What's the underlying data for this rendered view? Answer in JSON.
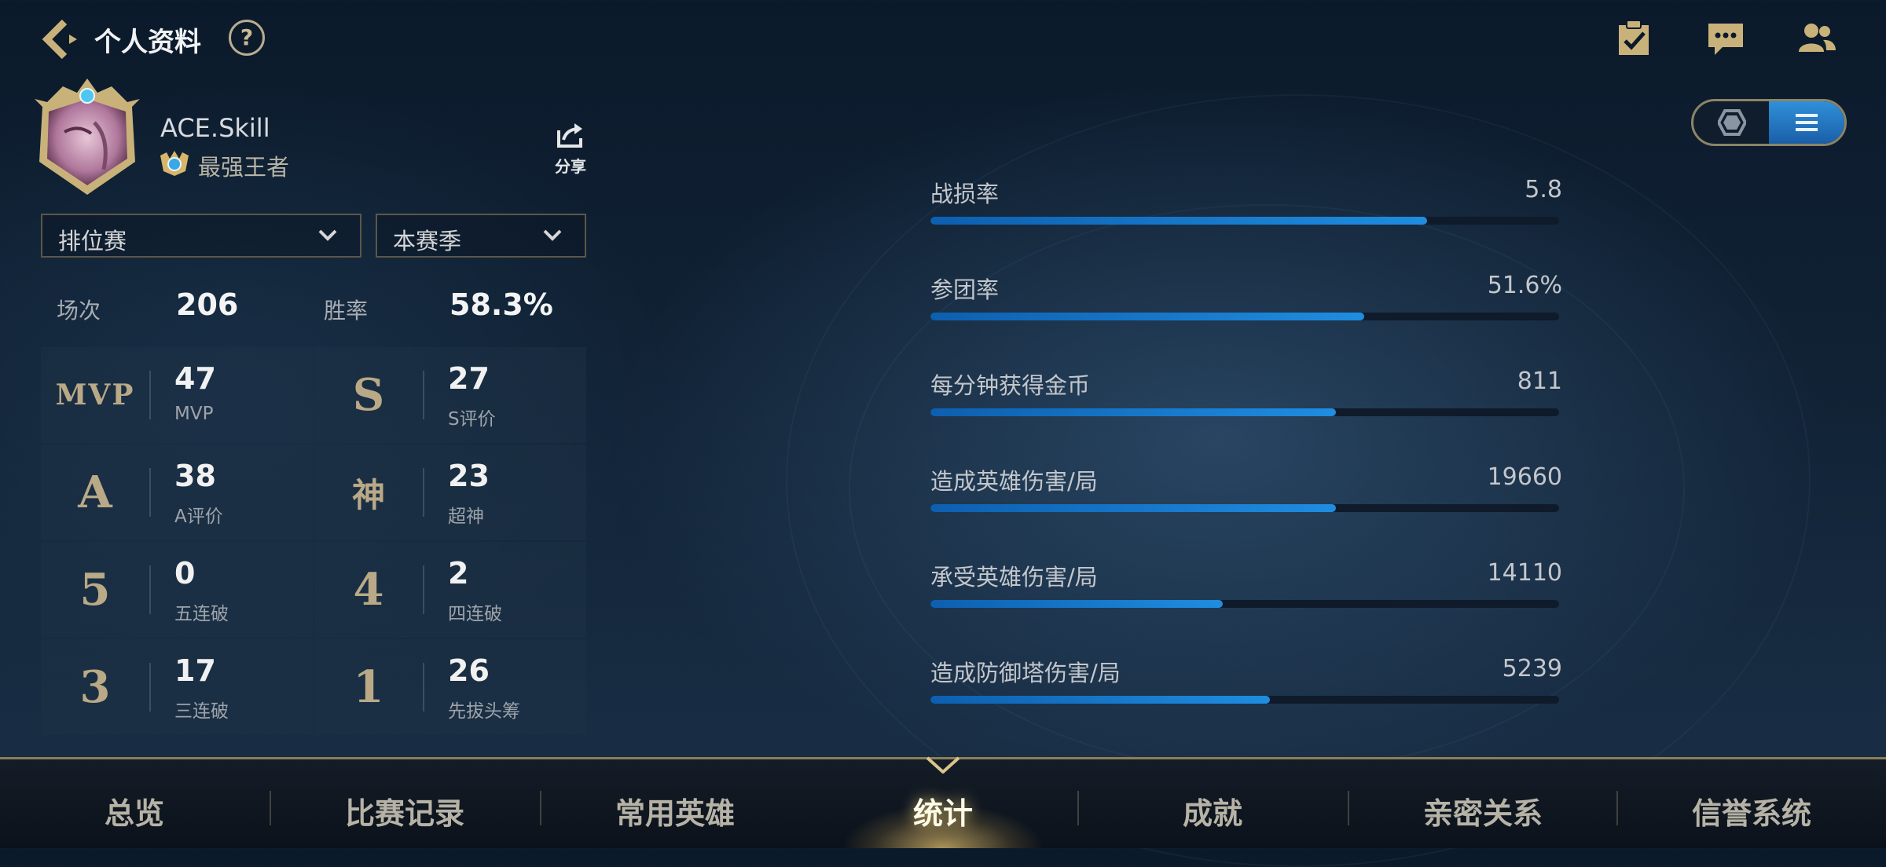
{
  "header": {
    "title": "个人资料",
    "help_symbol": "?"
  },
  "profile": {
    "username": "ACE.Skill",
    "rank": "最强王者",
    "share_label": "分享"
  },
  "filters": {
    "mode": "排位赛",
    "season": "本赛季"
  },
  "summary": {
    "games_label": "场次",
    "games_value": "206",
    "winrate_label": "胜率",
    "winrate_value": "58.3%"
  },
  "stats": [
    {
      "emblem": "MVP",
      "value": "47",
      "label": "MVP"
    },
    {
      "emblem": "S",
      "value": "27",
      "label": "S评价"
    },
    {
      "emblem": "A",
      "value": "38",
      "label": "A评价"
    },
    {
      "emblem": "神",
      "value": "23",
      "label": "超神"
    },
    {
      "emblem": "5",
      "value": "0",
      "label": "五连破"
    },
    {
      "emblem": "4",
      "value": "2",
      "label": "四连破"
    },
    {
      "emblem": "3",
      "value": "17",
      "label": "三连破"
    },
    {
      "emblem": "1",
      "value": "26",
      "label": "先拔头筹"
    }
  ],
  "side_id": "3935104",
  "metrics": [
    {
      "label": "战损率",
      "value": "5.8",
      "fill": 0.79
    },
    {
      "label": "参团率",
      "value": "51.6%",
      "fill": 0.69
    },
    {
      "label": "每分钟获得金币",
      "value": "811",
      "fill": 0.645
    },
    {
      "label": "造成英雄伤害/局",
      "value": "19660",
      "fill": 0.645
    },
    {
      "label": "承受英雄伤害/局",
      "value": "14110",
      "fill": 0.465
    },
    {
      "label": "造成防御塔伤害/局",
      "value": "5239",
      "fill": 0.54
    }
  ],
  "nav": {
    "active_index": 3,
    "items": [
      "总览",
      "比赛记录",
      "常用英雄",
      "统计",
      "成就",
      "亲密关系",
      "信誉系统"
    ]
  },
  "icons": {
    "back": "back-arrow-icon",
    "tasks": "checklist-icon",
    "chat": "chat-icon",
    "friends": "friends-icon",
    "share": "share-icon",
    "toggle_left": "hexagon-icon",
    "toggle_right": "list-icon"
  },
  "colors": {
    "accent_gold": "#b9a986",
    "bar_blue": "#1f8de0",
    "toggle_active": "#2f90d9"
  }
}
